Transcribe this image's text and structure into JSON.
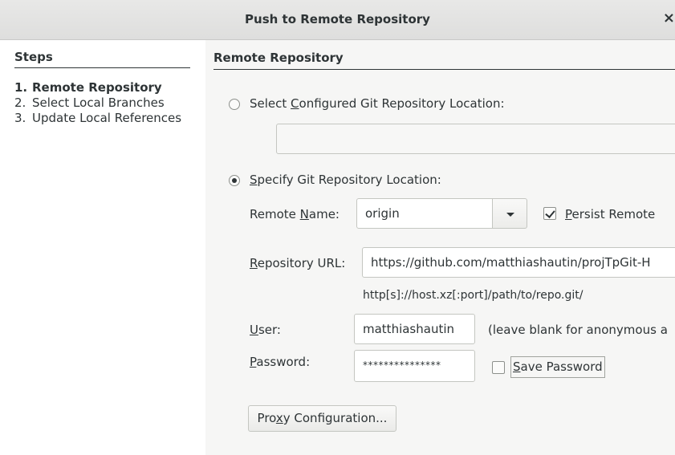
{
  "window": {
    "title": "Push to Remote Repository",
    "close_glyph": "×"
  },
  "steps": {
    "header": "Steps",
    "items": [
      {
        "num": "1.",
        "label": "Remote Repository",
        "current": true
      },
      {
        "num": "2.",
        "label": "Select Local Branches",
        "current": false
      },
      {
        "num": "3.",
        "label": "Update Local References",
        "current": false
      }
    ]
  },
  "panel": {
    "header": "Remote Repository",
    "configured_option": {
      "pre": "Select ",
      "mnemonic": "C",
      "post": "onfigured Git Repository Location:",
      "selected": false,
      "value": ""
    },
    "specify_option": {
      "pre": "",
      "mnemonic": "S",
      "post": "pecify Git Repository Location:",
      "selected": true
    },
    "remote_name": {
      "label_pre": "Remote ",
      "label_mnemonic": "N",
      "label_post": "ame:",
      "value": "origin"
    },
    "persist_remote": {
      "mnemonic": "P",
      "post": "ersist Remote",
      "checked": true
    },
    "repository_url": {
      "label_mnemonic": "R",
      "label_post": "epository URL:",
      "value": "https://github.com/matthiashautin/projTpGit-H",
      "hint": "http[s]://host.xz[:port]/path/to/repo.git/"
    },
    "user": {
      "label_mnemonic": "U",
      "label_post": "ser:",
      "value": "matthiashautin",
      "hint": "(leave blank for anonymous a"
    },
    "password": {
      "label_mnemonic": "P",
      "label_post": "assword:",
      "value": "***************"
    },
    "save_password": {
      "mnemonic": "S",
      "post": "ave Password",
      "checked": false
    },
    "proxy_button": {
      "pre": "Pro",
      "mnemonic": "x",
      "post": "y Configuration..."
    }
  }
}
